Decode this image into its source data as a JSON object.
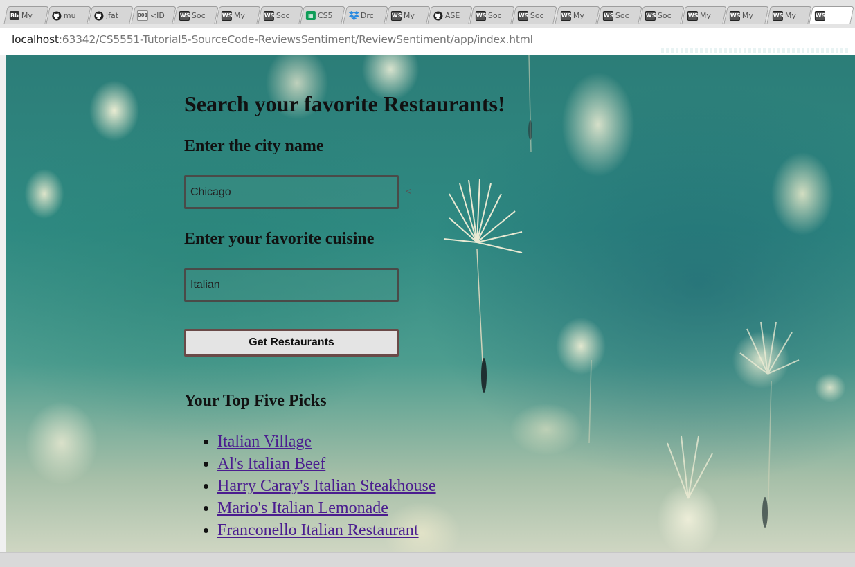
{
  "browser": {
    "tabs": [
      {
        "icon": "blackboard-icon",
        "icon_text": "Bb",
        "label": "My"
      },
      {
        "icon": "github-icon",
        "label": "mu"
      },
      {
        "icon": "github-icon",
        "label": "Jfat"
      },
      {
        "icon": "document-icon",
        "icon_text": "001",
        "label": "<ID"
      },
      {
        "icon": "ws-icon",
        "icon_text": "WS",
        "label": "Soc"
      },
      {
        "icon": "ws-icon",
        "icon_text": "WS",
        "label": "My"
      },
      {
        "icon": "ws-icon",
        "icon_text": "WS",
        "label": "Soc"
      },
      {
        "icon": "sheets-icon",
        "label": "CS5"
      },
      {
        "icon": "dropbox-icon",
        "label": "Drc"
      },
      {
        "icon": "ws-icon",
        "icon_text": "WS",
        "label": "My"
      },
      {
        "icon": "github-icon",
        "label": "ASE"
      },
      {
        "icon": "ws-icon",
        "icon_text": "WS",
        "label": "Soc"
      },
      {
        "icon": "ws-icon",
        "icon_text": "WS",
        "label": "Soc"
      },
      {
        "icon": "ws-icon",
        "icon_text": "WS",
        "label": "My"
      },
      {
        "icon": "ws-icon",
        "icon_text": "WS",
        "label": "Soc"
      },
      {
        "icon": "ws-icon",
        "icon_text": "WS",
        "label": "Soc"
      },
      {
        "icon": "ws-icon",
        "icon_text": "WS",
        "label": "My"
      },
      {
        "icon": "ws-icon",
        "icon_text": "WS",
        "label": "My"
      },
      {
        "icon": "ws-icon",
        "icon_text": "WS",
        "label": "My"
      },
      {
        "icon": "ws-icon",
        "icon_text": "WS",
        "label": "",
        "active": true
      }
    ],
    "url_host": "localhost",
    "url_rest": ":63342/CS5551-Tutorial5-SourceCode-ReviewsSentiment/ReviewSentiment/app/index.html"
  },
  "page": {
    "title": "Search your favorite Restaurants!",
    "city_label": "Enter the city name",
    "city_value": "Chicago",
    "caret": "<",
    "cuisine_label": "Enter your favorite cuisine",
    "cuisine_value": "Italian",
    "button_label": "Get Restaurants",
    "picks_title": "Your Top Five Picks",
    "picks": [
      "Italian Village",
      "Al's Italian Beef",
      "Harry Caray's Italian Steakhouse",
      "Mario's Italian Lemonade",
      "Franconello Italian Restaurant"
    ]
  },
  "colors": {
    "link": "#4b1d8f",
    "input_border": "#4a4a48",
    "button_border": "#6a4a48"
  }
}
